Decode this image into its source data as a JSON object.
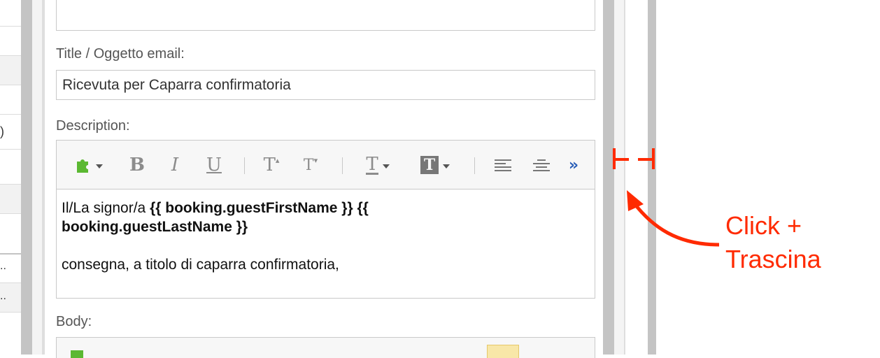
{
  "left_list": {
    "items": [
      "",
      "",
      "",
      ")",
      "",
      "",
      "",
      "..",
      ".."
    ]
  },
  "form": {
    "title_label": "Title / Oggetto email:",
    "title_value": "Ricevuta per Caparra confirmatoria",
    "description_label": "Description:",
    "body_label": "Body:"
  },
  "editor": {
    "toolbar": {
      "bold": "B",
      "italic": "I",
      "underline": "U",
      "font_size_up": "T",
      "font_size_down": "T",
      "text_color": "T",
      "bg_color": "T",
      "more": "»"
    },
    "content": {
      "line1_prefix": "Il/La signor/a ",
      "line1_bold": "{{ booking.guestFirstName }} {{",
      "line2_bold": "booking.guestLastName }}",
      "line3": "consegna, a titolo di caparra confirmatoria,"
    }
  },
  "annotation": {
    "line1": "Click +",
    "line2": "Trascina"
  },
  "colors": {
    "accent_red": "#ff2a00",
    "puzzle_green": "#5bb832",
    "more_blue": "#2a5fb8"
  }
}
